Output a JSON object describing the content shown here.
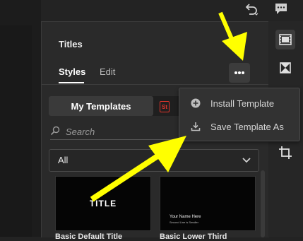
{
  "panel": {
    "title": "Titles",
    "tabs": [
      {
        "label": "Styles",
        "active": true
      },
      {
        "label": "Edit",
        "active": false
      }
    ],
    "more_button_icon": "more-horizontal-icon"
  },
  "templates_toggle": {
    "my_templates_label": "My Templates",
    "stock_badge": "St"
  },
  "search": {
    "placeholder": "Search"
  },
  "filter": {
    "selected": "All"
  },
  "templates": [
    {
      "thumb_text": "TITLE",
      "caption": "Basic Default Title"
    },
    {
      "thumb_name": "Your Name Here",
      "thumb_sub": "Second Line is Smaller",
      "caption": "Basic Lower Third"
    }
  ],
  "context_menu": {
    "items": [
      {
        "label": "Install Template",
        "icon": "plus-circle-icon"
      },
      {
        "label": "Save Template As",
        "icon": "download-icon"
      }
    ]
  },
  "top_bar": {
    "icons": [
      "undo-icon",
      "comment-icon"
    ]
  },
  "right_toolbar": {
    "icons": [
      "film-icon",
      "transition-icon",
      "crop-icon"
    ]
  },
  "colors": {
    "panel_bg": "#2a2a2a",
    "menu_bg": "#323232",
    "annotation_arrow": "#ffff00",
    "stock_badge": "#e0342b"
  }
}
